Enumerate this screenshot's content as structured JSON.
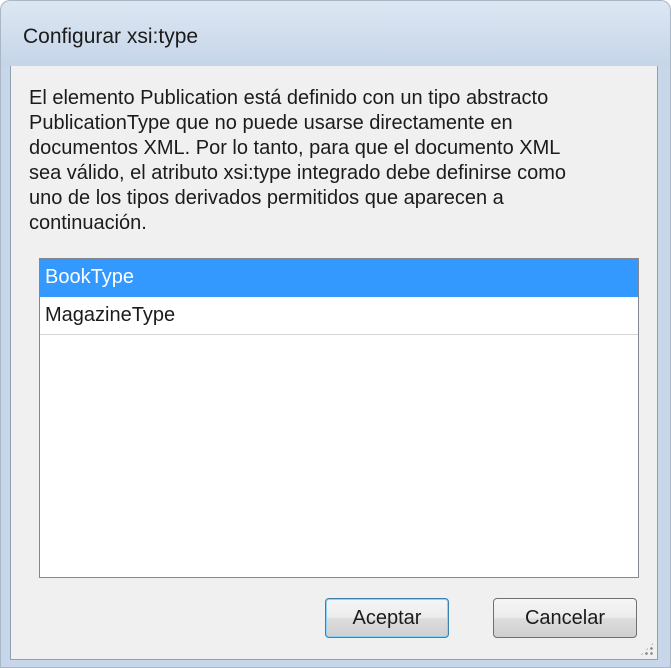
{
  "dialog": {
    "title": "Configurar xsi:type",
    "description": "El elemento Publication está definido con un tipo abstracto\nPublicationType que no puede usarse directamente en\ndocumentos XML. Por lo tanto, para que el documento XML\nsea válido, el atributo xsi:type integrado debe definirse como\nuno de los tipos derivados permitidos que aparecen a\ncontinuación.",
    "types": [
      {
        "label": "BookType",
        "selected": true
      },
      {
        "label": "MagazineType",
        "selected": false
      }
    ],
    "ok_label": "Aceptar",
    "cancel_label": "Cancelar"
  },
  "colors": {
    "selection": "#3399ff",
    "window_frame": "#c7d6e8",
    "client_bg": "#f0f0f0"
  }
}
